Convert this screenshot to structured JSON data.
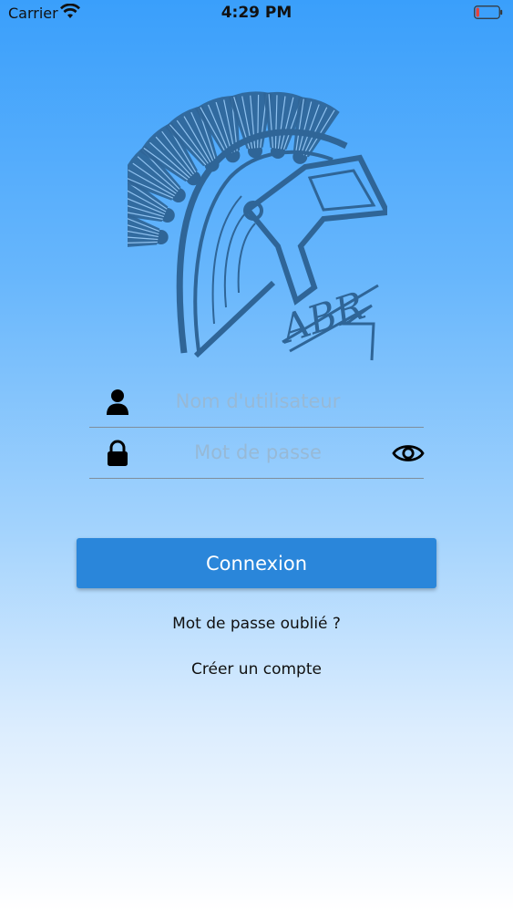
{
  "status_bar": {
    "carrier": "Carrier",
    "time": "4:29 PM",
    "battery_level_fraction": 0.15
  },
  "logo": {
    "text": "ABR",
    "color": "#2f6597"
  },
  "form": {
    "username_placeholder": "Nom d'utilisateur",
    "username_value": "",
    "password_placeholder": "Mot de passe",
    "password_value": "",
    "username_icon": "user-icon",
    "password_icon": "lock-icon",
    "toggle_icon": "eye-icon"
  },
  "actions": {
    "login_label": "Connexion",
    "forgot_label": "Mot de passe oublié ?",
    "create_label": "Créer un compte"
  },
  "colors": {
    "accent": "#2a86da",
    "placeholder": "#97b9d6",
    "logo": "#2f6597"
  }
}
